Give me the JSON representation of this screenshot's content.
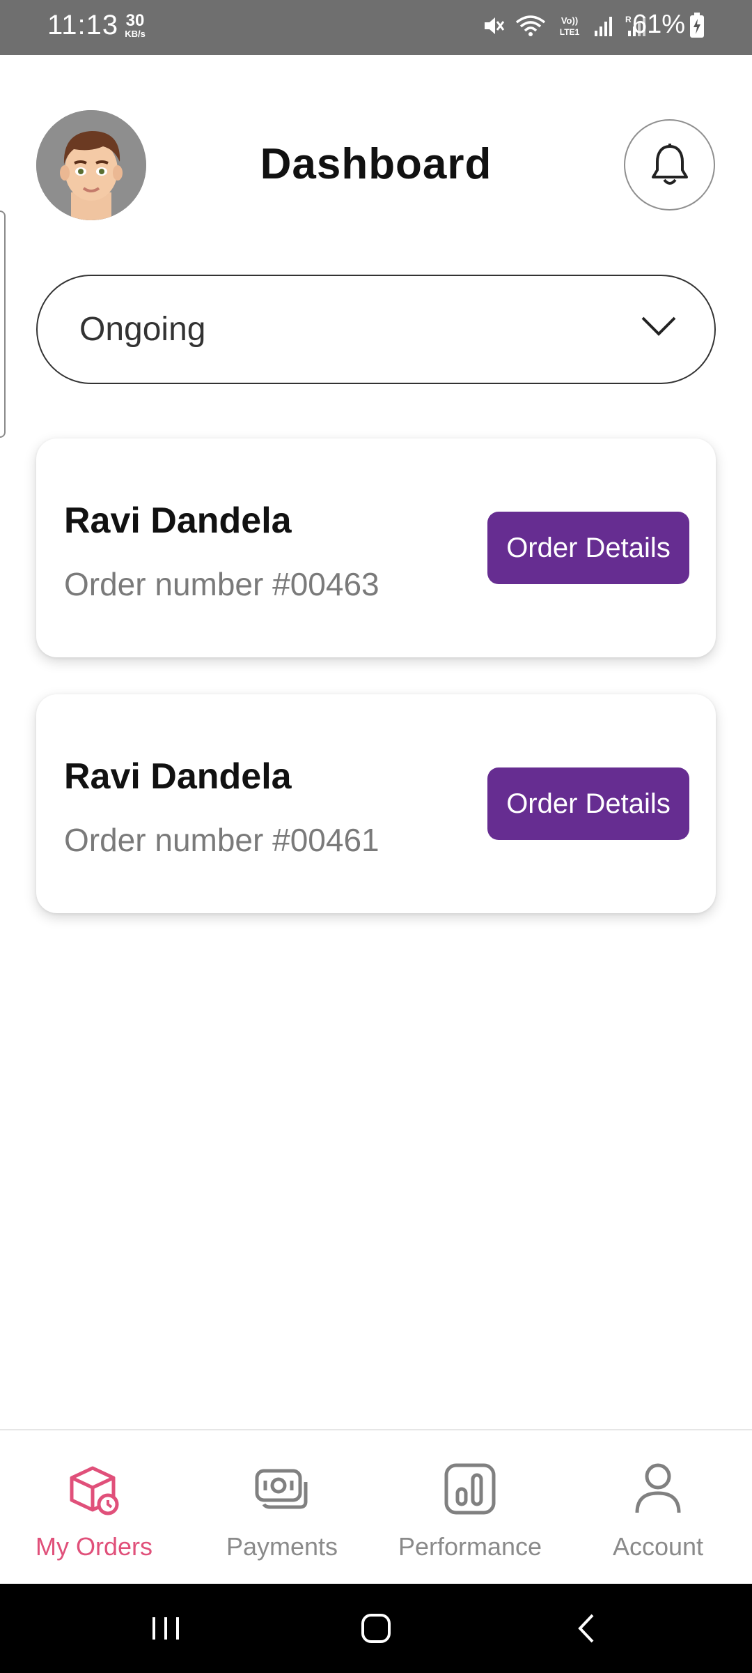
{
  "status_bar": {
    "time": "11:13",
    "net_speed": "30",
    "net_speed_unit": "KB/s",
    "battery": "61%",
    "icons": [
      "mute-icon",
      "wifi-icon",
      "volte-icon",
      "signal-icon",
      "signal-roaming-icon",
      "battery-icon"
    ]
  },
  "header": {
    "title": "Dashboard",
    "avatar_icon": "avatar",
    "bell_icon": "bell-icon"
  },
  "filter": {
    "selected": "Ongoing"
  },
  "orders": [
    {
      "customer": "Ravi Dandela",
      "order_number": "Order number #00463",
      "button_label": "Order Details"
    },
    {
      "customer": "Ravi Dandela",
      "order_number": "Order number #00461",
      "button_label": "Order Details"
    }
  ],
  "bottom_nav": [
    {
      "label": "My Orders",
      "icon": "orders-box-icon",
      "active": true
    },
    {
      "label": "Payments",
      "icon": "payments-icon",
      "active": false
    },
    {
      "label": "Performance",
      "icon": "performance-chart-icon",
      "active": false
    },
    {
      "label": "Account",
      "icon": "account-person-icon",
      "active": false
    }
  ],
  "colors": {
    "accent": "#662d91",
    "active_nav": "#e0507a",
    "status_bar": "#6f6f6f"
  }
}
